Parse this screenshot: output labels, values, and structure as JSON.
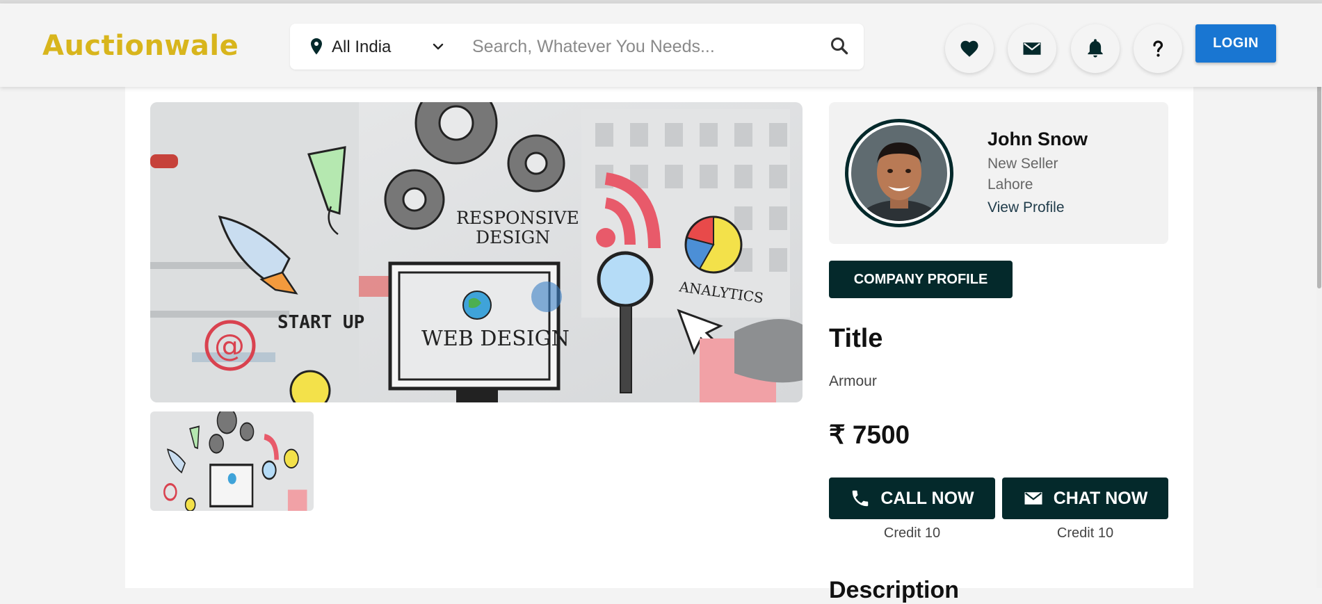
{
  "header": {
    "brand": "Auctionwale",
    "location": "All India",
    "search_placeholder": "Search, Whatever You Needs...",
    "login_label": "LOGIN",
    "icons": [
      "heart-icon",
      "mail-icon",
      "bell-icon",
      "help-icon"
    ]
  },
  "gallery": {
    "main_image_labels": [
      "RESPONSIVE DESIGN",
      "START UP",
      "WEB DESIGN",
      "ANALYTICS"
    ],
    "thumbnail_count": 1
  },
  "seller": {
    "name": "John Snow",
    "status": "New Seller",
    "city": "Lahore",
    "view_profile": "View Profile"
  },
  "company_profile_label": "COMPANY PROFILE",
  "listing": {
    "title_heading": "Title",
    "title_value": "Armour",
    "price": "₹ 7500"
  },
  "actions": {
    "call_label": "CALL NOW",
    "chat_label": "CHAT NOW",
    "call_credit": "Credit 10",
    "chat_credit": "Credit 10"
  },
  "description_heading": "Description",
  "colors": {
    "brand": "#d8b51c",
    "primary_dark": "#04292b",
    "login_blue": "#1976d2"
  }
}
